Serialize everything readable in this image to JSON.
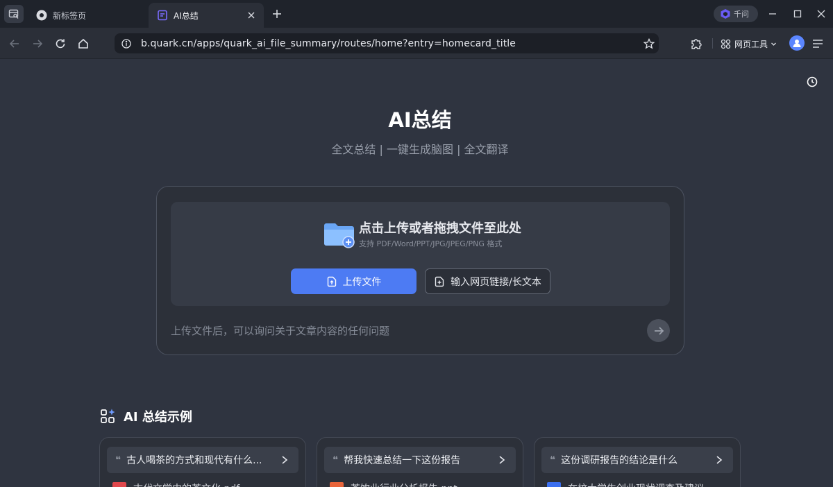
{
  "browser": {
    "tabs": [
      {
        "label": "新标签页",
        "active": false
      },
      {
        "label": "AI总结",
        "active": true
      }
    ],
    "qianwen_label": "千问",
    "url": "b.quark.cn/apps/quark_ai_file_summary/routes/home?entry=homecard_title",
    "web_tools_label": "网页工具"
  },
  "page": {
    "title": "AI总结",
    "subtitle": "全文总结 | 一键生成脑图 | 全文翻译",
    "upload": {
      "drop_title": "点击上传或者拖拽文件至此处",
      "drop_formats": "支持 PDF/Word/PPT/JPG/JPEG/PNG 格式",
      "upload_button": "上传文件",
      "link_button": "输入网页链接/长文本",
      "ask_placeholder": "上传文件后，可以询问关于文章内容的任何问题"
    },
    "examples": {
      "heading": "AI 总结示例",
      "cards": [
        {
          "question": "古人喝茶的方式和现代有什么...",
          "file": "古代文学中的茶文化.pdf",
          "file_color": "#e0474c"
        },
        {
          "question": "帮我快速总结一下这份报告",
          "file": "茶饮业行业分析报告.ppt",
          "file_color": "#e8643a"
        },
        {
          "question": "这份调研报告的结论是什么",
          "file": "在校大学生创业现状调查及建议",
          "file_color": "#3b6ff0"
        }
      ]
    }
  },
  "colors": {
    "background": "#2f3440",
    "accent": "#4d7bf3"
  }
}
